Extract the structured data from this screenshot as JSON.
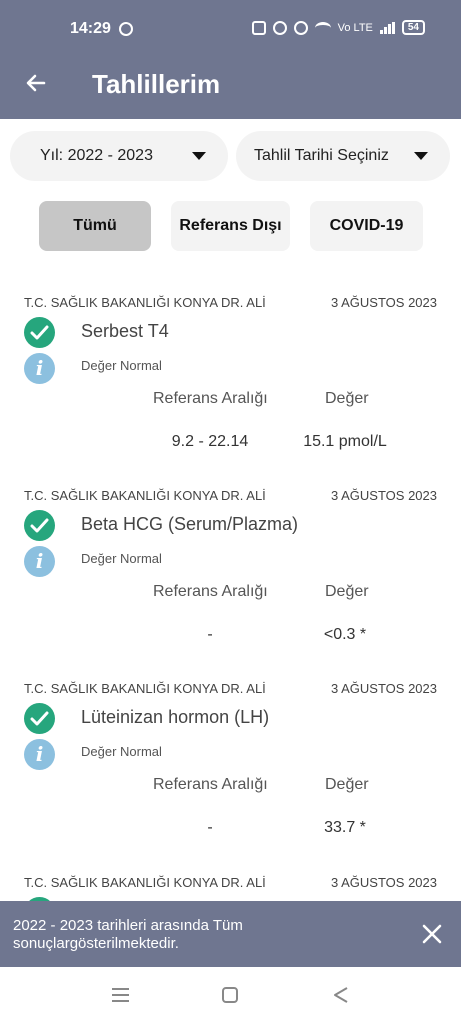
{
  "status_bar": {
    "time": "14:29",
    "battery": "54",
    "network": "Vo LTE"
  },
  "app_bar": {
    "title": "Tahlillerim",
    "back_icon": "arrow-left-icon"
  },
  "filters": {
    "year_select": "Yıl: 2022 - 2023",
    "date_select": "Tahlil Tarihi Seçiniz",
    "tabs": [
      {
        "label": "Tümü",
        "selected": true
      },
      {
        "label": "Referans Dışı",
        "selected": false
      },
      {
        "label": "COVID-19",
        "selected": false
      }
    ]
  },
  "results": [
    {
      "institution": "T.C. SAĞLIK BAKANLIĞI KONYA DR. ALİ",
      "date": "3 AĞUSTOS 2023",
      "name": "Serbest T4",
      "status": "Değer Normal",
      "ref_label": "Referans Aralığı",
      "value_label": "Değer",
      "ref_range": "9.2 - 22.14",
      "value": "15.1 pmol/L"
    },
    {
      "institution": "T.C. SAĞLIK BAKANLIĞI KONYA DR. ALİ",
      "date": "3 AĞUSTOS 2023",
      "name": "Beta HCG (Serum/Plazma)",
      "status": "Değer Normal",
      "ref_label": "Referans Aralığı",
      "value_label": "Değer",
      "ref_range": "-",
      "value": "<0.3 *"
    },
    {
      "institution": "T.C. SAĞLIK BAKANLIĞI KONYA DR. ALİ",
      "date": "3 AĞUSTOS 2023",
      "name": "Lüteinizan hormon (LH)",
      "status": "Değer Normal",
      "ref_label": "Referans Aralığı",
      "value_label": "Değer",
      "ref_range": "-",
      "value": "33.7 *"
    },
    {
      "institution": "T.C. SAĞLIK BAKANLIĞI KONYA DR. ALİ",
      "date": "3 AĞUSTOS 2023"
    }
  ],
  "snackbar": {
    "message": "2022 - 2023 tarihleri arasında Tüm sonuçlargösterilmektedir."
  },
  "colors": {
    "header": "#6f7690",
    "check": "#26a67d",
    "info": "#8cc0df",
    "selected_tab": "#c6c6c6"
  }
}
